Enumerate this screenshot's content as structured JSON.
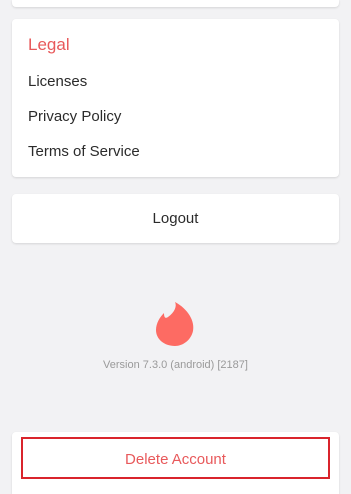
{
  "legal": {
    "title": "Legal",
    "items": [
      {
        "label": "Licenses"
      },
      {
        "label": "Privacy Policy"
      },
      {
        "label": "Terms of Service"
      }
    ]
  },
  "logout": {
    "label": "Logout"
  },
  "brand": {
    "icon": "tinder-flame-icon",
    "color": "#fd6b63"
  },
  "version_text": "Version 7.3.0 (android) [2187]",
  "delete_account": {
    "label": "Delete Account",
    "highlight_color": "#d9242c"
  },
  "colors": {
    "accent": "#e8595b",
    "background": "#f2f2f4",
    "card": "#ffffff",
    "text": "#2b2b2b",
    "muted": "#9a9a9a"
  }
}
